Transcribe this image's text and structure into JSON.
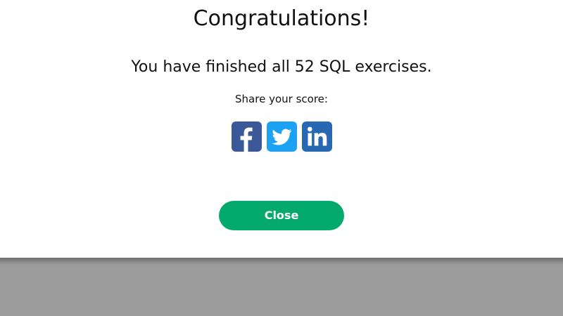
{
  "modal": {
    "title": "Congratulations!",
    "message": "You have finished all 52 SQL exercises.",
    "share_label": "Share your score:",
    "close_label": "Close"
  },
  "share_buttons": [
    {
      "icon": "facebook-icon",
      "color": "#3b5998"
    },
    {
      "icon": "twitter-icon",
      "color": "#1da1f2"
    },
    {
      "icon": "linkedin-icon",
      "color": "#2867b2"
    }
  ],
  "colors": {
    "accent": "#04aa6d",
    "backdrop": "#9b9b9b",
    "modal_bg": "#ffffff"
  }
}
